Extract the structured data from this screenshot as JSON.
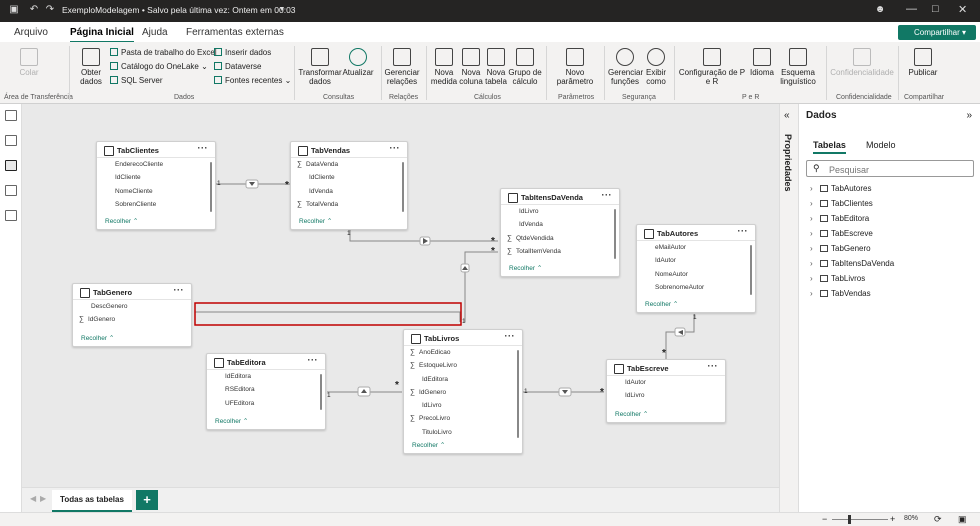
{
  "titlebar": {
    "title": "ExemploModelagem • Salvo pela última vez: Ontem em 00:03"
  },
  "menu": {
    "arquivo": "Arquivo",
    "pagina_inicial": "Página Inicial",
    "ajuda": "Ajuda",
    "ferramentas": "Ferramentas externas",
    "share": "Compartilhar"
  },
  "ribbon": {
    "colar": "Colar",
    "obter_dados": "Obter dados",
    "pasta_excel": "Pasta de trabalho do Excel",
    "onelake": "Catálogo do OneLake",
    "sql": "SQL Server",
    "inserir": "Inserir dados",
    "dataverse": "Dataverse",
    "fontes": "Fontes recentes",
    "transformar": "Transformar dados",
    "atualizar": "Atualizar",
    "gerenciar_rel": "Gerenciar relações",
    "nova_medida": "Nova medida",
    "nova_coluna": "Nova coluna",
    "nova_tabela": "Nova tabela",
    "grupo_calc": "Grupo de cálculo",
    "novo_param": "Novo parâmetro",
    "gerenciar_func": "Gerenciar funções",
    "exibir_como": "Exibir como",
    "config_pr": "Configuração de P e R",
    "idioma": "Idioma",
    "esquema": "Esquema linguístico",
    "confidencialidade": "Confidencialidade",
    "publicar": "Publicar",
    "g_area": "Área de Transferência",
    "g_dados": "Dados",
    "g_consultas": "Consultas",
    "g_relacoes": "Relações",
    "g_calculos": "Cálculos",
    "g_parametros": "Parâmetros",
    "g_seguranca": "Segurança",
    "g_per": "P e R",
    "g_conf": "Confidencialidade",
    "g_comp": "Compartilhar"
  },
  "tables": {
    "clientes": {
      "name": "TabClientes",
      "fields": [
        "EnderecoCliente",
        "IdCliente",
        "NomeCliente",
        "SobrenCliente"
      ]
    },
    "vendas": {
      "name": "TabVendas",
      "fields": [
        "DataVenda",
        "IdCliente",
        "IdVenda",
        "TotalVenda"
      ]
    },
    "itens": {
      "name": "TabItensDaVenda",
      "fields": [
        "IdLivro",
        "IdVenda",
        "QtdeVendida",
        "TotalItemVenda"
      ]
    },
    "autores": {
      "name": "TabAutores",
      "fields": [
        "eMailAutor",
        "IdAutor",
        "NomeAutor",
        "SobrenomeAutor"
      ]
    },
    "genero": {
      "name": "TabGenero",
      "fields": [
        "DescGenero",
        "IdGenero"
      ]
    },
    "editora": {
      "name": "TabEditora",
      "fields": [
        "IdEditora",
        "RSEditora",
        "UFEditora"
      ]
    },
    "livros": {
      "name": "TabLivros",
      "fields": [
        "AnoEdicao",
        "EstoqueLivro",
        "IdEditora",
        "IdGenero",
        "IdLivro",
        "PrecoLivro",
        "TituloLivro"
      ]
    },
    "escreve": {
      "name": "TabEscreve",
      "fields": [
        "IdAutor",
        "IdLivro"
      ]
    }
  },
  "recolher": "Recolher",
  "card_one": "1",
  "card_many": "*",
  "bottom": {
    "tab": "Todas as tabelas",
    "add": "+"
  },
  "props": {
    "label": "Propriedades"
  },
  "data_pane": {
    "title": "Dados",
    "tab_tabelas": "Tabelas",
    "tab_modelo": "Modelo",
    "search_placeholder": "Pesquisar",
    "items": [
      "TabAutores",
      "TabClientes",
      "TabEditora",
      "TabEscreve",
      "TabGenero",
      "TabItensDaVenda",
      "TabLivros",
      "TabVendas"
    ]
  },
  "zoom": "80%",
  "colors": {
    "accent": "#117865",
    "highlight": "#c00000"
  }
}
